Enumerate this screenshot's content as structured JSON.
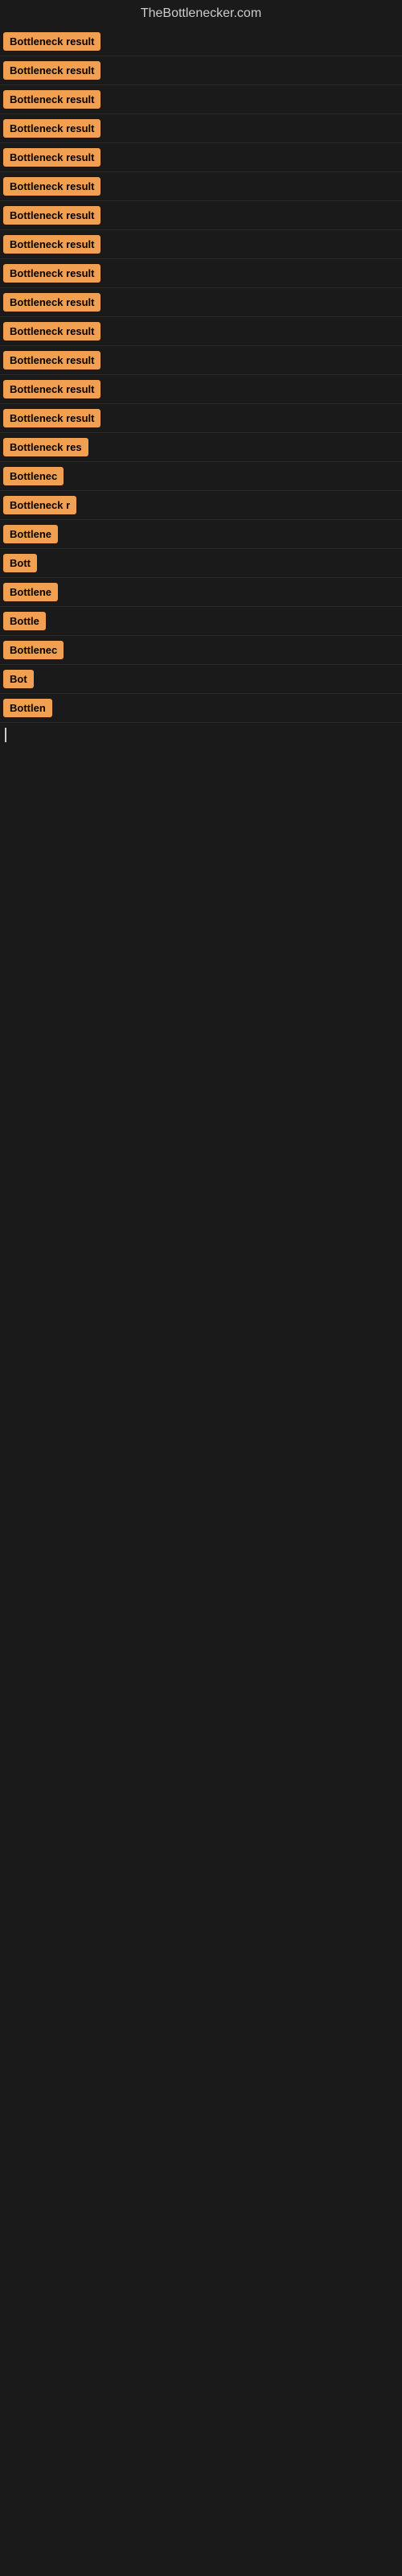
{
  "site": {
    "title": "TheBottlenecker.com"
  },
  "items": [
    {
      "id": 1,
      "label": "Bottleneck result",
      "width": "full"
    },
    {
      "id": 2,
      "label": "Bottleneck result",
      "width": "full"
    },
    {
      "id": 3,
      "label": "Bottleneck result",
      "width": "full"
    },
    {
      "id": 4,
      "label": "Bottleneck result",
      "width": "full"
    },
    {
      "id": 5,
      "label": "Bottleneck result",
      "width": "full"
    },
    {
      "id": 6,
      "label": "Bottleneck result",
      "width": "full"
    },
    {
      "id": 7,
      "label": "Bottleneck result",
      "width": "full"
    },
    {
      "id": 8,
      "label": "Bottleneck result",
      "width": "full"
    },
    {
      "id": 9,
      "label": "Bottleneck result",
      "width": "full"
    },
    {
      "id": 10,
      "label": "Bottleneck result",
      "width": "full"
    },
    {
      "id": 11,
      "label": "Bottleneck result",
      "width": "full"
    },
    {
      "id": 12,
      "label": "Bottleneck result",
      "width": "full"
    },
    {
      "id": 13,
      "label": "Bottleneck result",
      "width": "full"
    },
    {
      "id": 14,
      "label": "Bottleneck result",
      "width": "full"
    },
    {
      "id": 15,
      "label": "Bottleneck res",
      "width": "partial1"
    },
    {
      "id": 16,
      "label": "Bottlenec",
      "width": "partial2"
    },
    {
      "id": 17,
      "label": "Bottleneck r",
      "width": "partial3"
    },
    {
      "id": 18,
      "label": "Bottlene",
      "width": "partial4"
    },
    {
      "id": 19,
      "label": "Bott",
      "width": "partial5"
    },
    {
      "id": 20,
      "label": "Bottlene",
      "width": "partial4"
    },
    {
      "id": 21,
      "label": "Bottle",
      "width": "partial6"
    },
    {
      "id": 22,
      "label": "Bottlenec",
      "width": "partial2"
    },
    {
      "id": 23,
      "label": "Bot",
      "width": "partial7"
    },
    {
      "id": 24,
      "label": "Bottlen",
      "width": "partial8"
    }
  ]
}
